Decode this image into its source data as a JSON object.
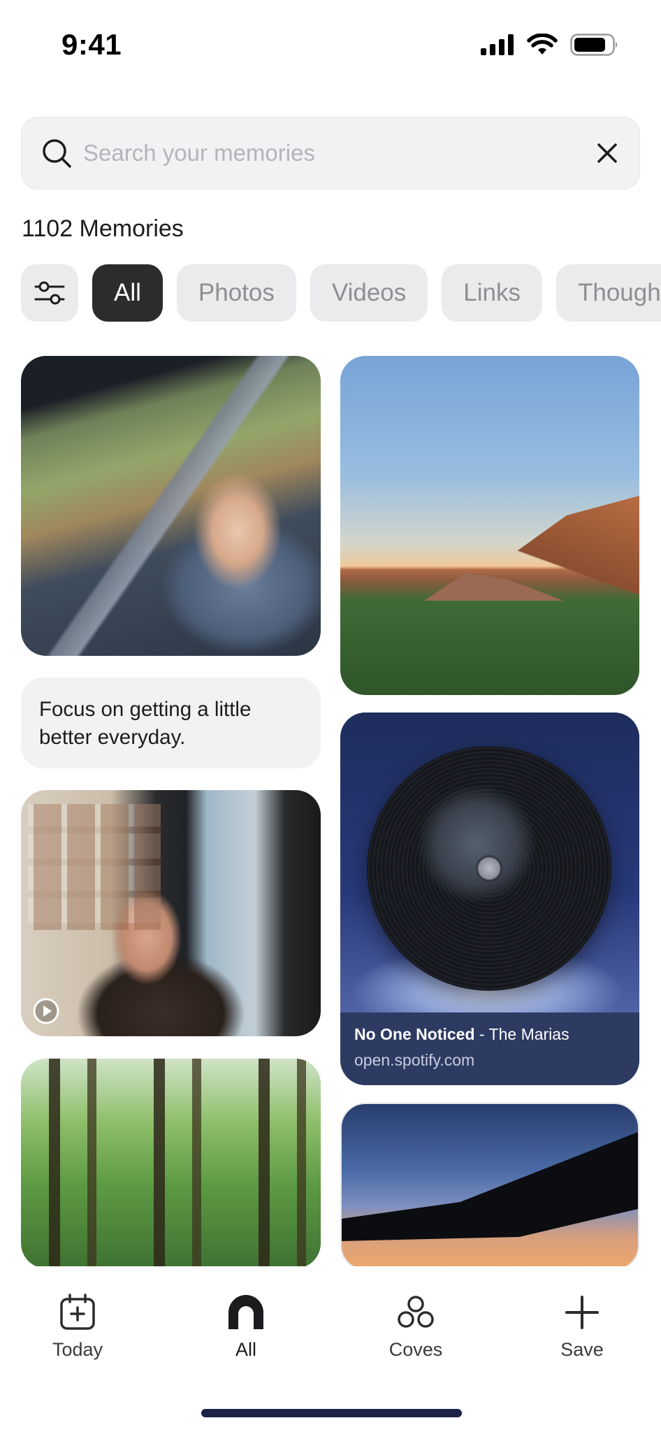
{
  "status_bar": {
    "time": "9:41",
    "icons": [
      "signal-icon",
      "wifi-icon",
      "battery-icon"
    ]
  },
  "search": {
    "placeholder": "Search your memories",
    "value": ""
  },
  "memories_count_label": "1102 Memories",
  "filters": {
    "chips": [
      {
        "label": "All",
        "active": true
      },
      {
        "label": "Photos",
        "active": false
      },
      {
        "label": "Videos",
        "active": false
      },
      {
        "label": "Links",
        "active": false
      },
      {
        "label": "Thoughts",
        "active": false
      }
    ]
  },
  "feed": {
    "thought_text": "Focus on getting a little better everyday.",
    "link": {
      "title": "No One Noticed",
      "separator": " - ",
      "artist": "The Marias",
      "domain": "open.spotify.com"
    }
  },
  "tab_bar": {
    "tabs": [
      {
        "label": "Today",
        "icon": "calendar-plus-icon",
        "active": false
      },
      {
        "label": "All",
        "icon": "arch-icon",
        "active": true
      },
      {
        "label": "Coves",
        "icon": "coves-icon",
        "active": false
      },
      {
        "label": "Save",
        "icon": "plus-icon",
        "active": false
      }
    ]
  },
  "colors": {
    "active_chip": "#2c2c2e",
    "chip": "#ebebed",
    "link_card": "#2d3a62",
    "home_indicator": "#1b2347"
  }
}
